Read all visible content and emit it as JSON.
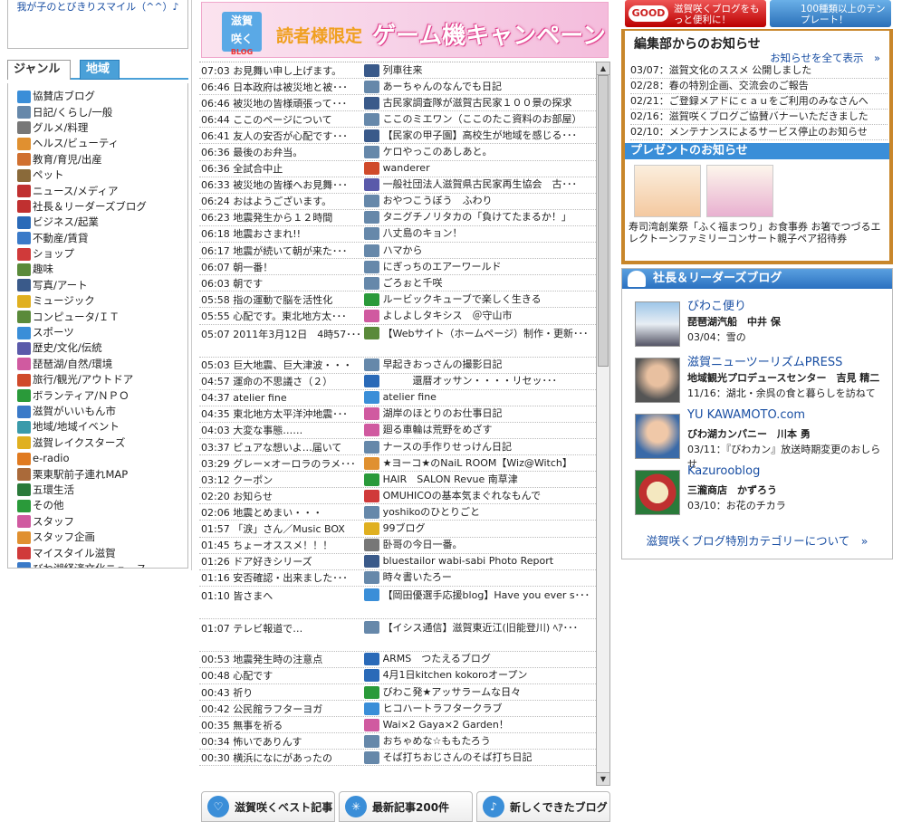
{
  "left": {
    "top_text": "我が子のとびきりスマイル（^^）♪",
    "tabs": {
      "genre": "ジャンル",
      "area": "地域"
    },
    "genres": [
      {
        "label": "協賛店ブログ",
        "icon": "house-icon",
        "color": "#3a8ed8"
      },
      {
        "label": "日記/くらし/一般",
        "icon": "book-icon",
        "color": "#6688aa"
      },
      {
        "label": "グルメ/料理",
        "icon": "cutlery-icon",
        "color": "#777"
      },
      {
        "label": "ヘルス/ビューティ",
        "icon": "face-icon",
        "color": "#e09030"
      },
      {
        "label": "教育/育児/出産",
        "icon": "family-icon",
        "color": "#d07030"
      },
      {
        "label": "ペット",
        "icon": "dog-icon",
        "color": "#8a6a3a"
      },
      {
        "label": "ニュース/メディア",
        "icon": "tv-icon",
        "color": "#c03030"
      },
      {
        "label": "社長＆リーダーズブログ",
        "icon": "leader-icon",
        "color": "#c03030"
      },
      {
        "label": "ビジネス/起業",
        "icon": "bag-icon",
        "color": "#2a6ab8"
      },
      {
        "label": "不動産/賃貸",
        "icon": "building-icon",
        "color": "#3a7ac8"
      },
      {
        "label": "ショップ",
        "icon": "gift-icon",
        "color": "#d03a3a"
      },
      {
        "label": "趣味",
        "icon": "hobby-icon",
        "color": "#5a8a3a"
      },
      {
        "label": "写真/アート",
        "icon": "camera-icon",
        "color": "#3a5a8a"
      },
      {
        "label": "ミュージック",
        "icon": "music-icon",
        "color": "#e0b020"
      },
      {
        "label": "コンピュータ/ＩＴ",
        "icon": "computer-icon",
        "color": "#5a8a3a"
      },
      {
        "label": "スポーツ",
        "icon": "sports-icon",
        "color": "#3a8ed8"
      },
      {
        "label": "歴史/文化/伝統",
        "icon": "castle-icon",
        "color": "#5a5aaa"
      },
      {
        "label": "琵琶湖/自然/環境",
        "icon": "lake-icon",
        "color": "#d05aa0"
      },
      {
        "label": "旅行/観光/アウトドア",
        "icon": "onsen-icon",
        "color": "#d04a2a"
      },
      {
        "label": "ボランティア/ＮＰＯ",
        "icon": "clover-icon",
        "color": "#2a9a3a"
      },
      {
        "label": "滋賀がいいもん市",
        "icon": "market-icon",
        "color": "#3a7ac8"
      },
      {
        "label": "地域/地域イベント",
        "icon": "event-icon",
        "color": "#3a9aaa"
      },
      {
        "label": "滋賀レイクスターズ",
        "icon": "star-icon",
        "color": "#e0b020"
      },
      {
        "label": "e-radio",
        "icon": "radio-icon",
        "color": "#e07a20"
      },
      {
        "label": "栗東駅前子連れMAP",
        "icon": "child-icon",
        "color": "#aa6a3a"
      },
      {
        "label": "五環生活",
        "icon": "five-icon",
        "color": "#2a7a3a"
      },
      {
        "label": "その他",
        "icon": "other-icon",
        "color": "#2a9a3a"
      },
      {
        "label": "スタッフ",
        "icon": "staff-icon",
        "color": "#d05aa0"
      },
      {
        "label": "スタッフ企画",
        "icon": "plan-icon",
        "color": "#e09030"
      },
      {
        "label": "マイスタイル滋賀",
        "icon": "mystyle-icon",
        "color": "#d03a3a"
      },
      {
        "label": "びわ湖経済文化ニュース",
        "icon": "news-icon",
        "color": "#3a7ac8"
      }
    ]
  },
  "banner": {
    "logo_top": "滋賀",
    "logo_bottom": "咲く",
    "logo_small": "BLOG",
    "sub": "読者様限定",
    "main": "ゲーム機キャンペーン"
  },
  "feed": [
    {
      "time": "07:03",
      "title": "お見舞い申し上げます。",
      "blog": "列車往来",
      "icon": "camera-icon",
      "color": "#3a5a8a"
    },
    {
      "time": "06:46",
      "title": "日本政府は被災地と被･･･",
      "blog": "あーちゃんのなんでも日記",
      "icon": "book-icon",
      "color": "#6688aa"
    },
    {
      "time": "06:46",
      "title": "被災地の皆様頑張って･･･",
      "blog": "古民家調査隊が滋賀古民家１００景の探求",
      "icon": "camera-icon",
      "color": "#3a5a8a"
    },
    {
      "time": "06:44",
      "title": "ここのページについて",
      "blog": "ここのミエワン（ここのたこ資料のお部屋）",
      "icon": "book-icon",
      "color": "#6688aa"
    },
    {
      "time": "06:41",
      "title": "友人の安否が心配です･･･",
      "blog": "【民家の甲子園】高校生が地域を感じる･･･",
      "icon": "camera-icon",
      "color": "#3a5a8a"
    },
    {
      "time": "06:36",
      "title": "最後のお弁当。",
      "blog": "ケロやっこのあしあと。",
      "icon": "book-icon",
      "color": "#6688aa"
    },
    {
      "time": "06:36",
      "title": "全試合中止",
      "blog": "wanderer",
      "icon": "onsen-icon",
      "color": "#d04a2a"
    },
    {
      "time": "06:33",
      "title": "被災地の皆様へお見舞･･･",
      "blog": "一般社団法人滋賀県古民家再生協会　古･･･",
      "icon": "castle-icon",
      "color": "#5a5aaa"
    },
    {
      "time": "06:24",
      "title": "おはようございます。",
      "blog": "おやつこうぼう　ふわり",
      "icon": "book-icon",
      "color": "#6688aa"
    },
    {
      "time": "06:23",
      "title": "地震発生から１２時間",
      "blog": "タニグチノリタカの「負けてたまるか！」",
      "icon": "book-icon",
      "color": "#6688aa"
    },
    {
      "time": "06:18",
      "title": "地震おさまれ!!",
      "blog": "八丈島のキョン！",
      "icon": "book-icon",
      "color": "#6688aa"
    },
    {
      "time": "06:17",
      "title": "地震が続いて朝が来た･･･",
      "blog": "ハマから",
      "icon": "book-icon",
      "color": "#6688aa"
    },
    {
      "time": "06:07",
      "title": "朝一番！",
      "blog": "にぎっちのエアーワールド",
      "icon": "book-icon",
      "color": "#6688aa"
    },
    {
      "time": "06:03",
      "title": "朝です",
      "blog": "ごろぉと千咲",
      "icon": "book-icon",
      "color": "#6688aa"
    },
    {
      "time": "05:58",
      "title": "指の運動で脳を活性化",
      "blog": "ルービックキューブで楽しく生きる",
      "icon": "clover-icon",
      "color": "#2a9a3a"
    },
    {
      "time": "05:55",
      "title": "心配です。東北地方太･･･",
      "blog": "よしよしタキシス　＠守山市",
      "icon": "lake-icon",
      "color": "#d05aa0"
    },
    {
      "time": "05:07",
      "title": "2011年3月12日　4時57･･･",
      "blog": "【Webサイト（ホームページ）制作・更新･･･",
      "icon": "computer-icon",
      "color": "#5a8a3a",
      "tall": true
    },
    {
      "time": "05:03",
      "title": "巨大地震、巨大津波・・・",
      "blog": "早起きおっさんの撮影日記",
      "icon": "book-icon",
      "color": "#6688aa"
    },
    {
      "time": "04:57",
      "title": "運命の不思議さ（２）",
      "blog": "　　　還暦オッサン・・・・リセッ･･･",
      "icon": "bag-icon",
      "color": "#2a6ab8"
    },
    {
      "time": "04:37",
      "title": "atelier fine",
      "blog": "atelier fine",
      "icon": "house-icon",
      "color": "#3a8ed8"
    },
    {
      "time": "04:35",
      "title": "東北地方太平洋沖地震･･･",
      "blog": "湖岸のほとりのお仕事日記",
      "icon": "staff-icon",
      "color": "#d05aa0"
    },
    {
      "time": "04:03",
      "title": "大変な事態……",
      "blog": "廻る車輪は荒野をめざす",
      "icon": "staff-icon",
      "color": "#d05aa0"
    },
    {
      "time": "03:37",
      "title": "ピュアな想いよ…届いて",
      "blog": "ナースの手作りせっけん日記",
      "icon": "book-icon",
      "color": "#6688aa"
    },
    {
      "time": "03:29",
      "title": "グレー×オーロラのラメ･･･",
      "blog": "★ヨーコ★のNaiL ROOM【Wiz@Witch】",
      "icon": "face-icon",
      "color": "#e09030"
    },
    {
      "time": "03:12",
      "title": "クーポン",
      "blog": "HAIR　SALON Revue 南草津",
      "icon": "building-icon",
      "color": "#2a9a3a"
    },
    {
      "time": "02:20",
      "title": "お知らせ",
      "blog": "OMUHICOの基本気まぐれなもんで",
      "icon": "gift-icon",
      "color": "#d03a3a"
    },
    {
      "time": "02:06",
      "title": "地震とめまい・・・",
      "blog": "yoshikoのひとりごと",
      "icon": "book-icon",
      "color": "#6688aa"
    },
    {
      "time": "01:57",
      "title": "「涙」さん／Music BOX",
      "blog": "99ブログ",
      "icon": "music-icon",
      "color": "#e0b020"
    },
    {
      "time": "01:45",
      "title": "ちょーオススメ！！！",
      "blog": "卧哥の今日一番。",
      "icon": "cutlery-icon",
      "color": "#777"
    },
    {
      "time": "01:26",
      "title": "ドア好きシリーズ",
      "blog": "bluestailor wabi-sabi Photo Report",
      "icon": "camera-icon",
      "color": "#3a5a8a"
    },
    {
      "time": "01:16",
      "title": "安否確認・出来ました･･･",
      "blog": "時々書いたろー",
      "icon": "book-icon",
      "color": "#6688aa"
    },
    {
      "time": "01:10",
      "title": "皆さまへ",
      "blog": "【岡田優選手応援blog】Have you ever s･･･",
      "icon": "sports-icon",
      "color": "#3a8ed8",
      "tall": true
    },
    {
      "time": "01:07",
      "title": "テレビ報道で…",
      "blog": "【イシス通信】滋賀東近江(旧能登川) ﾍｱ･･･",
      "icon": "book-icon",
      "color": "#6688aa",
      "tall": true
    },
    {
      "time": "00:53",
      "title": "地震発生時の注意点",
      "blog": "ARMS　つたえるブログ",
      "icon": "bag-icon",
      "color": "#2a6ab8"
    },
    {
      "time": "00:48",
      "title": "心配です",
      "blog": "4月1日kitchen kokoroオープン",
      "icon": "bag-icon",
      "color": "#2a6ab8"
    },
    {
      "time": "00:43",
      "title": "祈り",
      "blog": "びわこ発★アッサラームな日々",
      "icon": "clover-icon",
      "color": "#2a9a3a"
    },
    {
      "time": "00:42",
      "title": "公民館ラフターヨガ",
      "blog": "ヒコハートラフタークラブ",
      "icon": "sports-icon",
      "color": "#3a8ed8"
    },
    {
      "time": "00:35",
      "title": "無事を祈る",
      "blog": "Wai×2 Gaya×2 Garden！",
      "icon": "lake-icon",
      "color": "#d05aa0"
    },
    {
      "time": "00:34",
      "title": "怖いでありんす",
      "blog": "おちゃめな☆ももたろう",
      "icon": "book-icon",
      "color": "#6688aa"
    },
    {
      "time": "00:30",
      "title": "横浜になにがあったの",
      "blog": "そば打ちおじさんのそば打ち日記",
      "icon": "book-icon",
      "color": "#6688aa"
    }
  ],
  "bottom_buttons": [
    {
      "label": "滋賀咲くベスト記事",
      "icon": "heart-icon"
    },
    {
      "label": "最新記事200件",
      "icon": "sparkle-icon"
    },
    {
      "label": "新しくできたブログ",
      "icon": "note-icon"
    }
  ],
  "right": {
    "ads": [
      {
        "tag": "GOOD",
        "text": "滋賀咲くブログをもっと便利に！"
      },
      {
        "text": "100種類以上のテンプレート！"
      }
    ],
    "notice": {
      "title": "編集部からのお知らせ",
      "all_link": "お知らせを全て表示　»",
      "items": [
        "03/07：滋賀文化のススメ 公開しました",
        "02/28：春の特別企画、交流会のご報告",
        "02/21：ご登録メアドにｃａｕをご利用のみなさんへ",
        "02/16：滋賀咲くブログご協賛バナーいただきました",
        "02/10：メンテナンスによるサービス停止のお知らせ"
      ]
    },
    "presents": {
      "title": "プレゼントのお知らせ",
      "text": "寿司湾創業祭「ふく福まつり」お食事券 お箸でつづるエレクトーンファミリーコンサート親子ペア招待券"
    },
    "ceo": {
      "title": "社長＆リーダーズブログ",
      "entries": [
        {
          "blog": "びわこ便り",
          "owner": "琵琶湖汽船　中井 保",
          "post": "03/04：雪の"
        },
        {
          "blog": "滋賀ニューツーリズムPRESS",
          "owner": "地域観光プロデュースセンター　吉見 精二",
          "post": "11/16：湖北・余呉の食と暮らしを訪ねて"
        },
        {
          "blog": "YU KAWAMOTO.com",
          "owner": "びわ湖カンパニー　川本 勇",
          "post": "03/11：『びわカン』放送時期変更のおしらせ"
        },
        {
          "blog": "Kazurooblog",
          "owner": "三瀧商店　かずろう",
          "post": "03/10：お花のチカラ"
        }
      ],
      "more": "滋賀咲くブログ特別カテゴリーについて　»"
    }
  }
}
